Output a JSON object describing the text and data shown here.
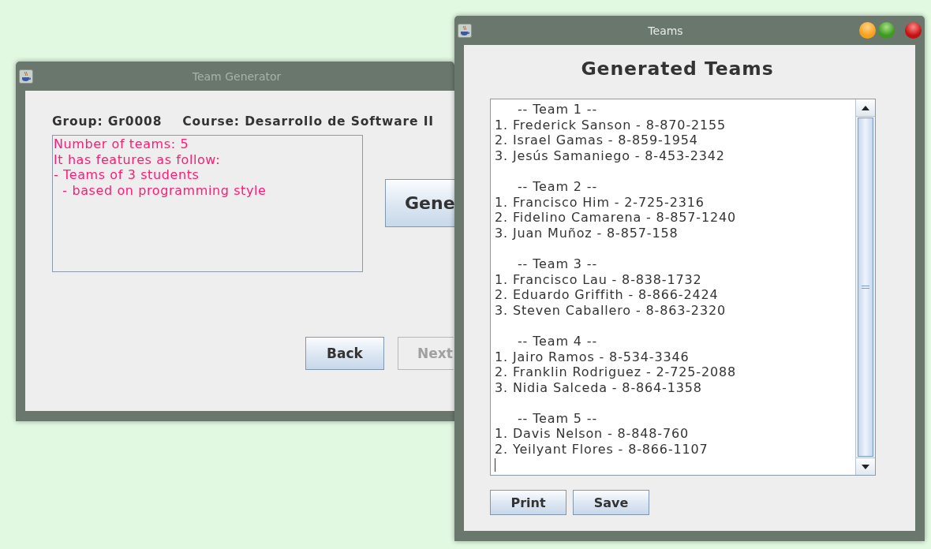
{
  "generator_window": {
    "title": "Team Generator",
    "active": false,
    "group_label": "Group: Gr0008",
    "course_label": "Course: Desarrollo de Software II",
    "description": [
      "Number of teams: 5",
      "It has features as follow:",
      "- Teams of 3 students",
      "  - based on programming style"
    ],
    "generate_button": "Gene",
    "buttons": [
      {
        "label": "Back",
        "disabled": false
      },
      {
        "label": "Next",
        "disabled": true
      }
    ]
  },
  "teams_window": {
    "title": "Teams",
    "active": true,
    "heading": "Generated Teams",
    "teams": [
      {
        "header": "-- Team 1 --",
        "members": [
          "1. Frederick Sanson - 8-870-2155",
          "2. Israel Gamas - 8-859-1954",
          "3. Jesús Samaniego - 8-453-2342"
        ]
      },
      {
        "header": "-- Team 2 --",
        "members": [
          "1. Francisco Him - 2-725-2316",
          "2. Fidelino Camarena - 8-857-1240",
          "3. Juan Muñoz - 8-857-158"
        ]
      },
      {
        "header": "-- Team 3 --",
        "members": [
          "1. Francisco Lau - 8-838-1732",
          "2. Eduardo Griffith - 8-866-2424",
          "3. Steven Caballero - 8-863-2320"
        ]
      },
      {
        "header": "-- Team 4 --",
        "members": [
          "1. Jairo Ramos - 8-534-3346",
          "2. Franklin Rodriguez - 2-725-2088",
          "3. Nidia Salceda - 8-864-1358"
        ]
      },
      {
        "header": "-- Team 5 --",
        "members": [
          "1. Davis Nelson - 8-848-760",
          "2. Yeilyant Flores - 8-866-1107"
        ]
      }
    ],
    "buttons": [
      "Print",
      "Save"
    ]
  }
}
